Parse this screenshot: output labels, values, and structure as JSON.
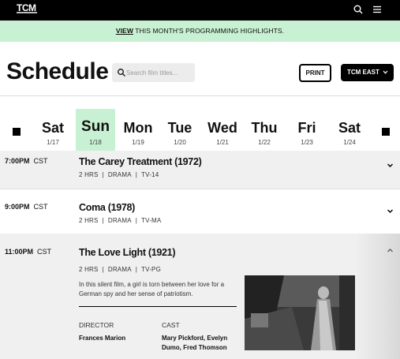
{
  "topbar": {
    "logo": "TCM",
    "search_icon": "search-icon",
    "menu_icon": "hamburger-menu-icon"
  },
  "banner": {
    "link_label": "VIEW",
    "text": " THIS MONTH'S PROGRAMMING HIGHLIGHTS."
  },
  "header": {
    "title": "Schedule",
    "search_placeholder": "Search film titles...",
    "print_label": "PRINT",
    "timezone_label": "TCM EAST"
  },
  "days": [
    {
      "name": "Sat",
      "date": "1/17",
      "active": false
    },
    {
      "name": "Sun",
      "date": "1/18",
      "active": true
    },
    {
      "name": "Mon",
      "date": "1/19",
      "active": false
    },
    {
      "name": "Tue",
      "date": "1/20",
      "active": false
    },
    {
      "name": "Wed",
      "date": "1/21",
      "active": false
    },
    {
      "name": "Thu",
      "date": "1/22",
      "active": false
    },
    {
      "name": "Fri",
      "date": "1/23",
      "active": false
    },
    {
      "name": "Sat",
      "date": "1/24",
      "active": false
    }
  ],
  "programs": [
    {
      "time": "7:00PM",
      "zone": "CST",
      "title": "The Carey Treatment (1972)",
      "duration": "2 HRS",
      "genre": "DRAMA",
      "rating": "TV-14",
      "expanded": false
    },
    {
      "time": "9:00PM",
      "zone": "CST",
      "title": "Coma (1978)",
      "duration": "2 HRS",
      "genre": "DRAMA",
      "rating": "TV-MA",
      "expanded": false
    },
    {
      "time": "11:00PM",
      "zone": "CST",
      "title": "The Love Light (1921)",
      "duration": "2 HRS",
      "genre": "DRAMA",
      "rating": "TV-PG",
      "expanded": true,
      "description": "In this silent film, a girl is torn between her love for a German spy and her sense of patriotism.",
      "director_label": "DIRECTOR",
      "director": "Frances Marion",
      "cast_label": "CAST",
      "cast_line1": "Mary Pickford, Evelyn",
      "cast_line2": "Dumo, Fred Thomson"
    }
  ],
  "colors": {
    "accent_green": "#c8f0d2",
    "row_gray": "#f0f0f0",
    "black": "#000000"
  }
}
